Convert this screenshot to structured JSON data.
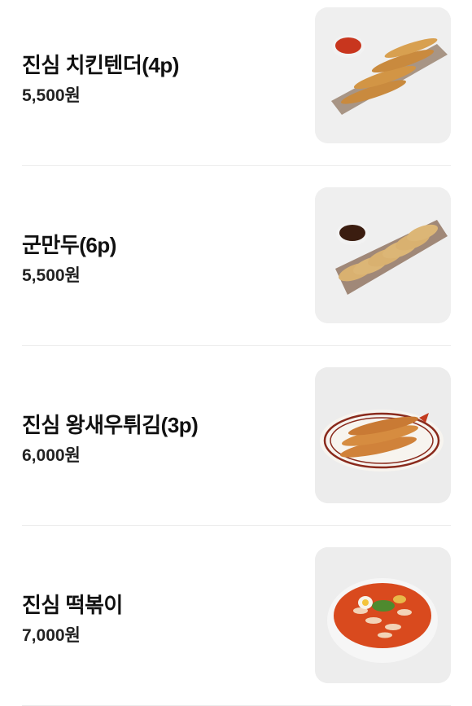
{
  "menu": {
    "items": [
      {
        "name": "진심 치킨텐더(4p)",
        "price": "5,500원",
        "image_icon": "chicken-tender-photo"
      },
      {
        "name": "군만두(6p)",
        "price": "5,500원",
        "image_icon": "fried-dumpling-photo"
      },
      {
        "name": "진심 왕새우튀김(3p)",
        "price": "6,000원",
        "image_icon": "fried-shrimp-photo"
      },
      {
        "name": "진심 떡볶이",
        "price": "7,000원",
        "image_icon": "tteokbokki-photo"
      }
    ]
  },
  "colors": {
    "text": "#111111",
    "divider": "#ececec",
    "thumb_bg": "#ececec"
  }
}
